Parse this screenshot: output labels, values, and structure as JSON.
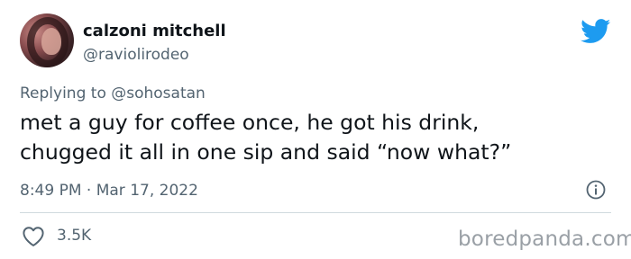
{
  "author": {
    "display_name": "calzoni mitchell",
    "handle": "@raviolirodeo"
  },
  "reply": {
    "prefix": "Replying to",
    "target": "@sohosatan"
  },
  "tweet": {
    "lines": [
      "met a guy for coffee once, he got his drink,",
      "chugged it all in one sip and said “now what?”"
    ],
    "time": "8:49 PM",
    "separator": "·",
    "date": "Mar 17, 2022"
  },
  "engagement": {
    "likes": "3.5K"
  },
  "watermark": "boredpanda.com",
  "icons": {
    "brand": "twitter-bird-icon",
    "info": "info-icon",
    "like": "heart-icon"
  },
  "colors": {
    "brand": "#1d9bf0",
    "text": "#0f1419",
    "secondary": "#536471",
    "divider": "#cfd9de",
    "watermark": "#9aa0a6"
  }
}
